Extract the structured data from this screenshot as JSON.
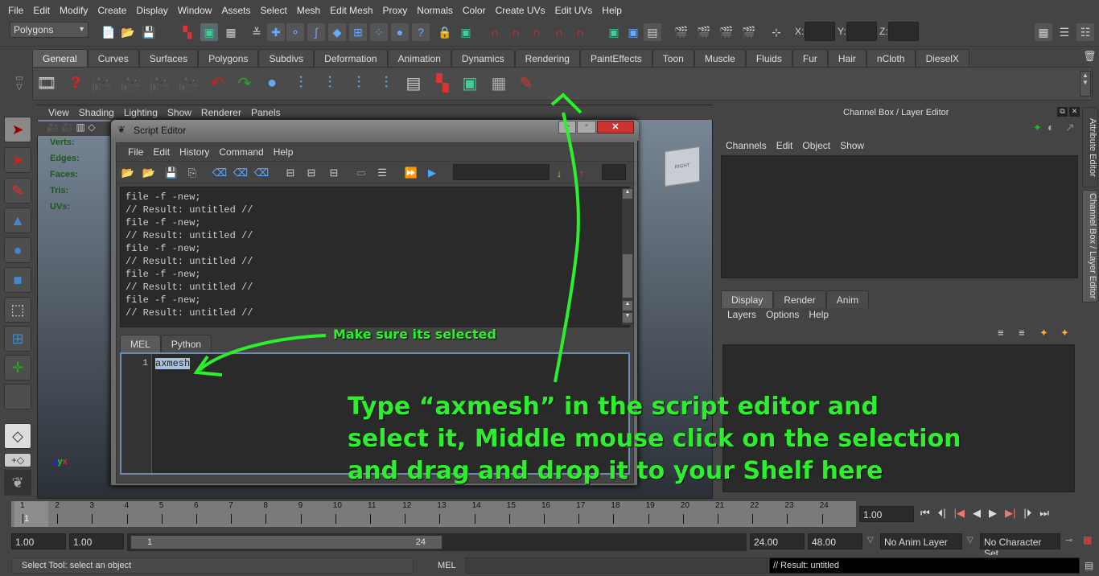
{
  "menubar": [
    "File",
    "Edit",
    "Modify",
    "Create",
    "Display",
    "Window",
    "Assets",
    "Select",
    "Mesh",
    "Edit Mesh",
    "Proxy",
    "Normals",
    "Color",
    "Create UVs",
    "Edit UVs",
    "Help"
  ],
  "toolbar": {
    "mode_select": "Polygons",
    "coord_labels": [
      "X:",
      "Y:",
      "Z:"
    ]
  },
  "shelf": {
    "tabs": [
      "General",
      "Curves",
      "Surfaces",
      "Polygons",
      "Subdivs",
      "Deformation",
      "Animation",
      "Dynamics",
      "Rendering",
      "PaintEffects",
      "Toon",
      "Muscle",
      "Fluids",
      "Fur",
      "Hair",
      "nCloth",
      "DieselX"
    ],
    "active": "General"
  },
  "viewport": {
    "menu": [
      "View",
      "Shading",
      "Lighting",
      "Show",
      "Renderer",
      "Panels"
    ],
    "hud": [
      "Verts:",
      "Edges:",
      "Faces:",
      "Tris:",
      "UVs:"
    ],
    "cube_label": "RIGHT"
  },
  "script_editor": {
    "title": "Script Editor",
    "menu": [
      "File",
      "Edit",
      "History",
      "Command",
      "Help"
    ],
    "history": [
      "file -f -new;",
      "// Result: untitled //",
      "file -f -new;",
      "// Result: untitled //",
      "file -f -new;",
      "// Result: untitled //",
      "file -f -new;",
      "// Result: untitled //",
      "file -f -new;",
      "// Result: untitled //"
    ],
    "tabs": [
      "MEL",
      "Python"
    ],
    "line_number": "1",
    "code": "axmesh"
  },
  "channel_box": {
    "title": "Channel Box / Layer Editor",
    "menu": [
      "Channels",
      "Edit",
      "Object",
      "Show"
    ]
  },
  "layer_editor": {
    "tabs": [
      "Display",
      "Render",
      "Anim"
    ],
    "menu": [
      "Layers",
      "Options",
      "Help"
    ]
  },
  "side_tabs": [
    "Attribute Editor",
    "Channel Box / Layer Editor"
  ],
  "timeline": {
    "ticks": [
      "1",
      "2",
      "3",
      "4",
      "5",
      "6",
      "7",
      "8",
      "9",
      "10",
      "11",
      "12",
      "13",
      "14",
      "15",
      "16",
      "17",
      "18",
      "19",
      "20",
      "21",
      "22",
      "23",
      "24"
    ],
    "current": "1",
    "current_field": "1.00"
  },
  "range": {
    "start": "1.00",
    "anim_start": "1.00",
    "slider_start": "1",
    "slider_end": "24",
    "end": "24.00",
    "anim_end": "48.00",
    "anim_layer": "No Anim Layer",
    "char_set": "No Character Set"
  },
  "status": {
    "help": "Select Tool: select an object",
    "lang": "MEL",
    "result": "// Result: untitled"
  },
  "annotations": {
    "note1": "Make sure its selected",
    "note2_lines": [
      "Type “axmesh”  in the script editor and",
      "select it, Middle mouse click on the selection",
      "and drag and drop it to your Shelf here"
    ]
  }
}
